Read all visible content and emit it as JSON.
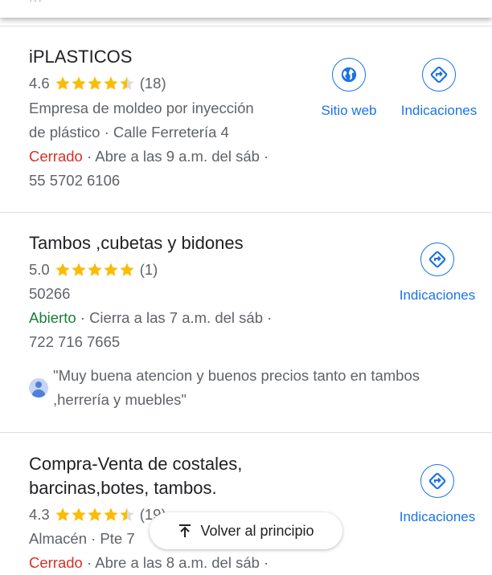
{
  "top_strip": {
    "dots": "···"
  },
  "listings": [
    {
      "name": "iPLASTICOS",
      "rating": "4.6",
      "stars": 4.5,
      "reviews": "(18)",
      "category_line1": "Empresa de moldeo por inyección",
      "category_line2": "de plástico · Calle Ferretería 4",
      "status": "Cerrado",
      "hours": " · Abre a las 9 a.m. del sáb ·",
      "phone": "55 5702 6106",
      "website_label": "Sitio web",
      "directions_label": "Indicaciones"
    },
    {
      "name": "Tambos ,cubetas y bidones",
      "rating": "5.0",
      "stars": 5,
      "reviews": "(1)",
      "category_line1": "50266",
      "status": "Abierto",
      "hours": " · Cierra a las 7 a.m. del sáb ·",
      "phone": "722 716 7665",
      "review_text": "\"Muy buena atencion y buenos precios tanto en tambos ,herrería y muebles\"",
      "directions_label": "Indicaciones"
    },
    {
      "name_line1": "Compra-Venta de costales,",
      "name_line2": "barcinas,botes, tambos.",
      "rating": "4.3",
      "stars": 4.5,
      "reviews": "(19)",
      "category_line1": "Almacén · Pte 7",
      "status": "Cerrado",
      "hours": " · Abre a las 8 a.m. del sáb ·",
      "directions_label": "Indicaciones"
    }
  ],
  "back_to_top": {
    "label": "Volver al principio"
  },
  "colors": {
    "star": "#fbbc04",
    "star_empty": "#dadce0",
    "link": "#1a73e8",
    "closed": "#d93025",
    "open": "#188038"
  },
  "icons": {
    "website": "globe-icon",
    "directions": "directions-icon",
    "back": "arrow-up-icon",
    "user": "avatar-icon"
  }
}
